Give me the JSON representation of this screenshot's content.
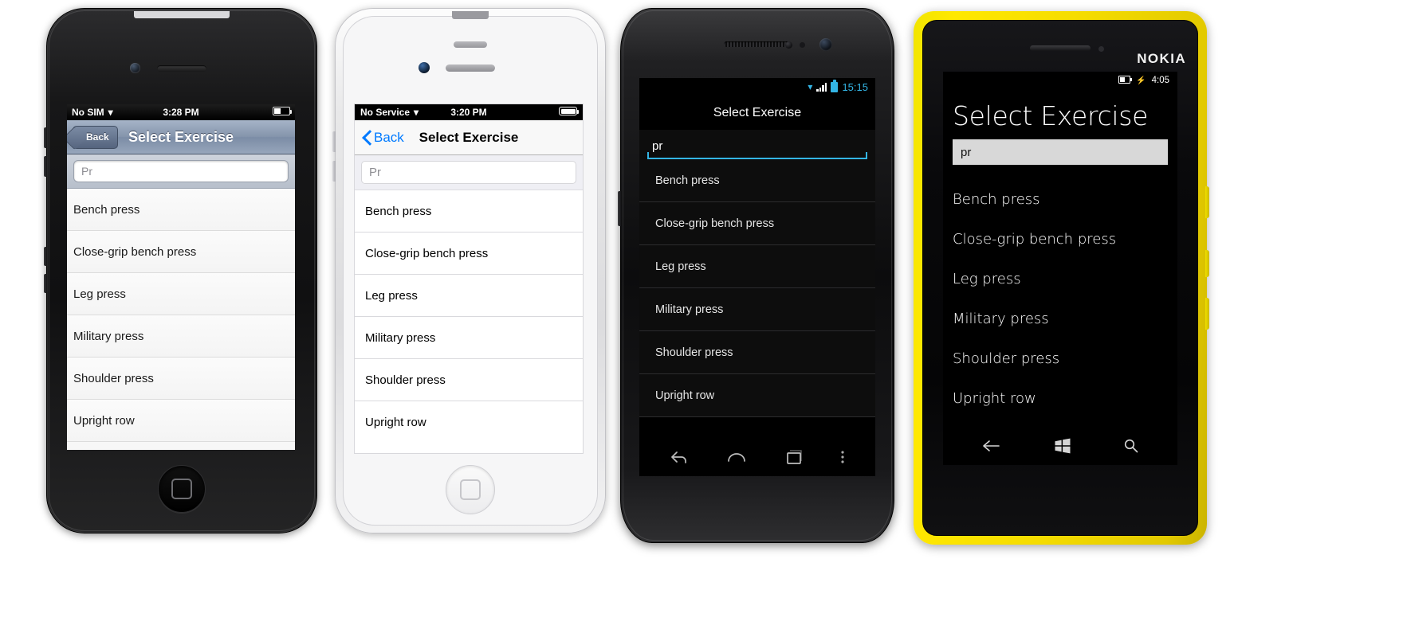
{
  "app": {
    "title": "Select Exercise",
    "search_value_capitalized": "Pr",
    "search_value_lowercase": "pr",
    "back_label": "Back",
    "exercises": [
      "Bench press",
      "Close-grip bench press",
      "Leg press",
      "Military press",
      "Shoulder press",
      "Upright row"
    ]
  },
  "devices": [
    {
      "platform": "ios6",
      "name": "black-iphone-ios6",
      "status": {
        "carrier": "No SIM",
        "wifi_icon": "wifi-icon",
        "time": "3:28 PM",
        "battery_icon": "battery-icon"
      },
      "navbar": {
        "back_label": "Back",
        "title": "Select Exercise"
      },
      "search_value": "Pr"
    },
    {
      "platform": "ios7",
      "name": "white-iphone-ios7",
      "status": {
        "carrier": "No Service",
        "wifi_icon": "wifi-icon",
        "time": "3:20 PM",
        "battery_icon": "battery-icon"
      },
      "navbar": {
        "back_label": "Back",
        "title": "Select Exercise"
      },
      "search_value": "Pr"
    },
    {
      "platform": "android",
      "name": "android-galaxy-nexus",
      "status": {
        "wifi_icon": "wifi-icon",
        "signal_icon": "signal-bars-icon",
        "battery_icon": "battery-icon",
        "time": "15:15"
      },
      "actionbar": {
        "title": "Select Exercise"
      },
      "search_value": "pr",
      "navigation": {
        "back_icon": "back-arrow-icon",
        "home_icon": "home-icon",
        "recents_icon": "recent-apps-icon",
        "overflow_icon": "overflow-menu-icon"
      },
      "accent_color": "#33b5e5"
    },
    {
      "platform": "windowsphone",
      "name": "nokia-lumia-windows-phone",
      "brand": "NOKIA",
      "status": {
        "battery_icon": "battery-charging-icon",
        "time": "4:05"
      },
      "header": {
        "title": "Select Exercise"
      },
      "search_value": "pr",
      "navigation": {
        "back_icon": "back-arrow-icon",
        "start_icon": "windows-start-icon",
        "search_icon": "search-icon"
      },
      "shell_color": "#f2e500"
    }
  ]
}
